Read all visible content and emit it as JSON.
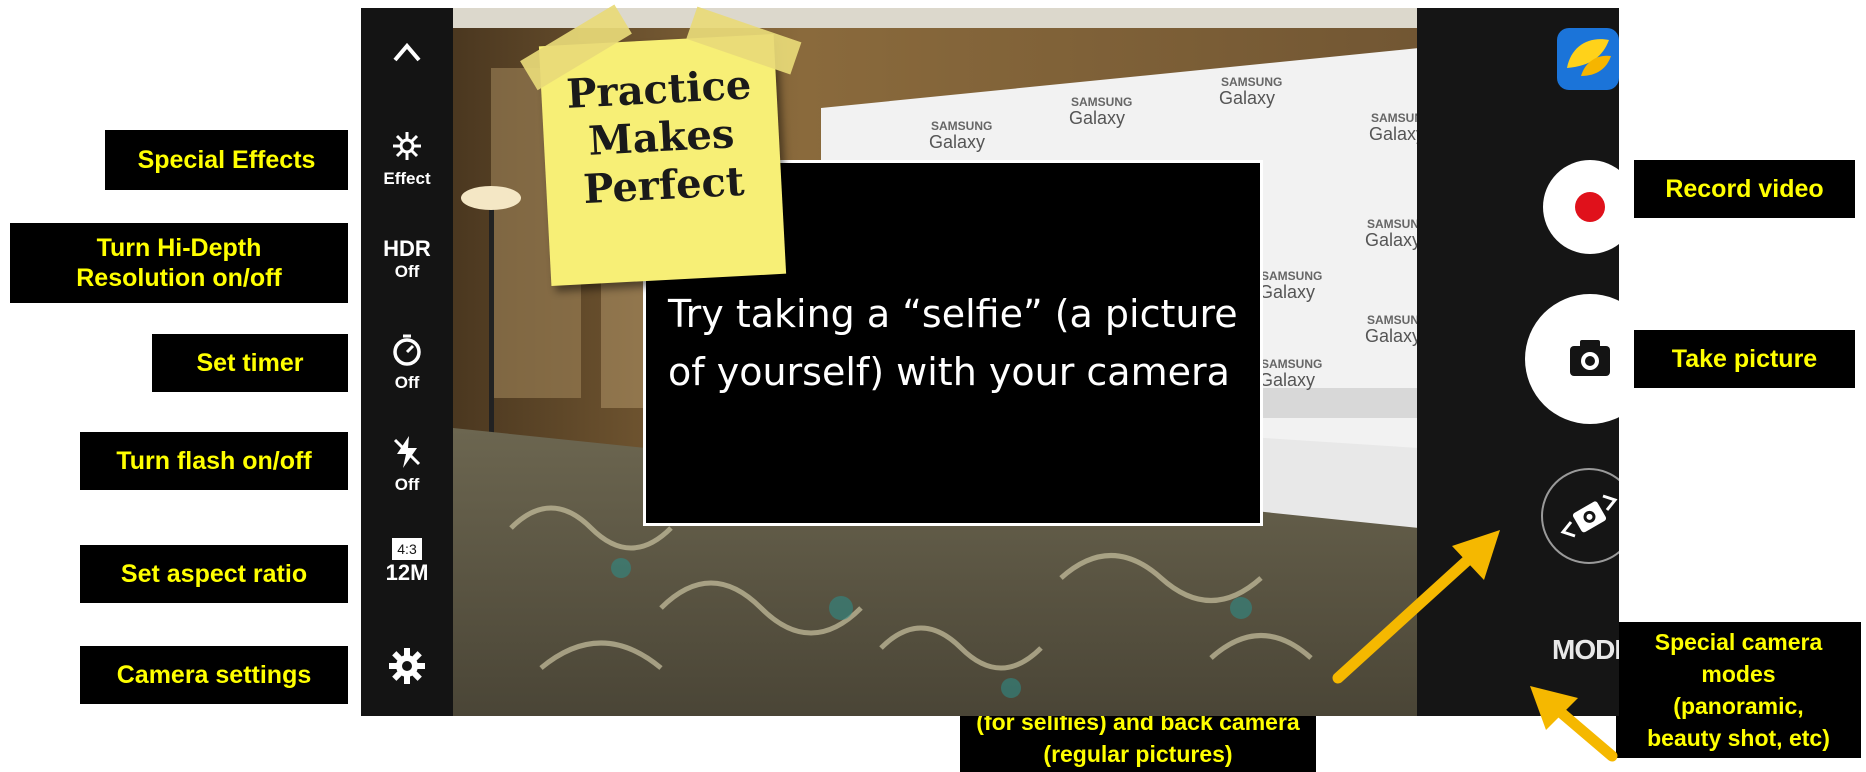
{
  "annotations": {
    "special_effects": "Special Effects",
    "hi_depth": "Turn Hi-Depth\nResolution on/off",
    "set_timer": "Set timer",
    "flash": "Turn flash on/off",
    "aspect_ratio": "Set aspect ratio",
    "camera_settings": "Camera settings",
    "record_video": "Record video",
    "take_picture": "Take picture",
    "switch_camera": "Switch between front camera\n(for selifies) and back camera\n(regular pictures)",
    "camera_modes": "Special camera\nmodes\n(panoramic,\nbeauty shot, etc)"
  },
  "left_bar": {
    "effect_label": "Effect",
    "hdr_label": "HDR",
    "hdr_value": "Off",
    "timer_value": "Off",
    "flash_value": "Off",
    "aspect_ratio": "4:3",
    "resolution": "12M"
  },
  "right_bar": {
    "mode_label": "MODE"
  },
  "sticky_note": {
    "text": "Practice\nMakes\nPerfect"
  },
  "instruction": {
    "text": "Try taking a “selfie” (a picture of yourself) with your camera"
  },
  "backdrop": {
    "brand_line1": "SAMSUNG",
    "brand_line2": "Galaxy"
  },
  "icons": {
    "up": "chevron-up-icon",
    "effect": "sparkle-icon",
    "timer": "timer-icon",
    "flash": "flash-off-icon",
    "settings": "gear-icon",
    "record": "record-icon",
    "camera": "camera-icon",
    "switch": "switch-camera-icon",
    "gallery": "gallery-thumbnail-icon"
  },
  "colors": {
    "label_text": "#ffff00",
    "label_bg": "#000000",
    "arrow": "#f5b800",
    "record_red": "#e0111b",
    "sticky_note": "#f7ef76"
  }
}
